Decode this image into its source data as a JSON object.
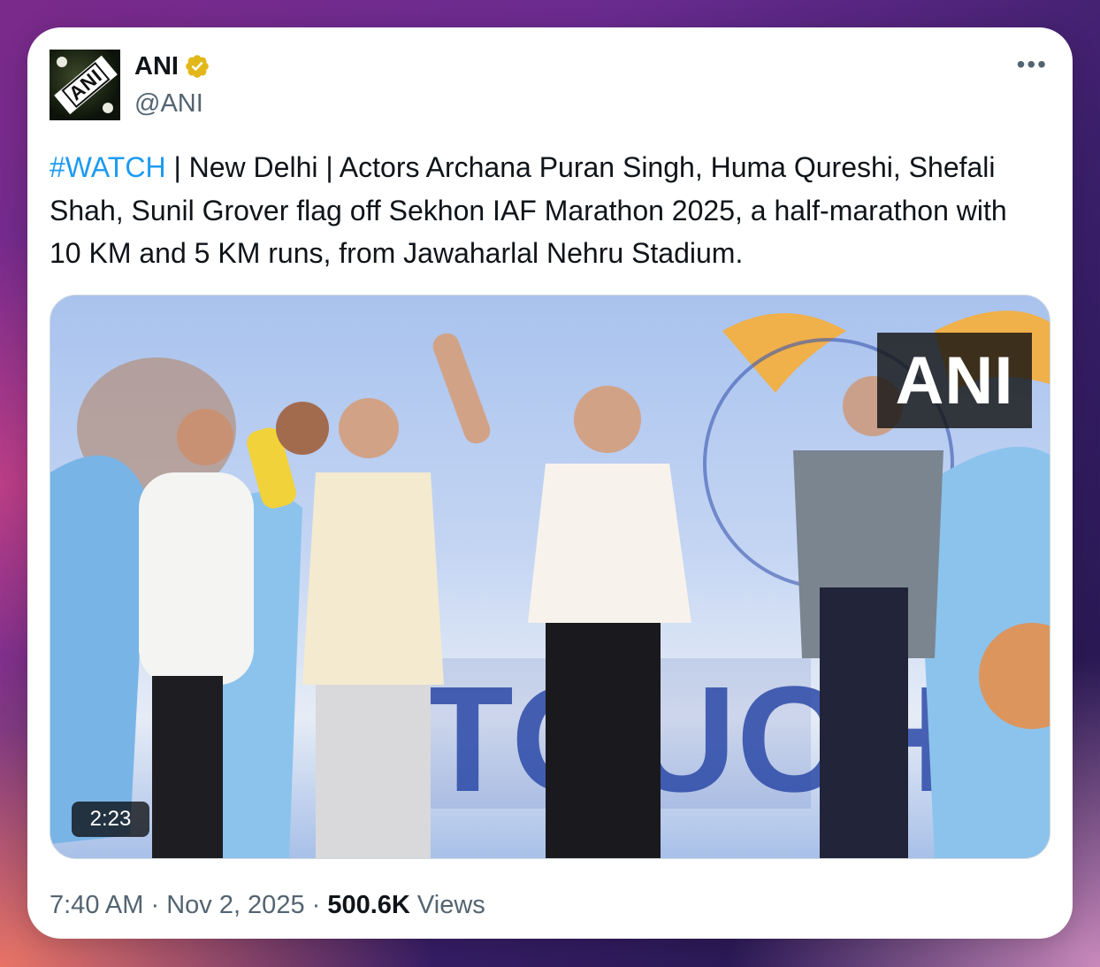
{
  "author": {
    "name": "ANI",
    "handle": "@ANI",
    "avatar_text": "ANI"
  },
  "more_menu_icon": "more-horizontal-icon",
  "tweet": {
    "hashtag": "#WATCH",
    "text": " | New Delhi | Actors Archana Puran Singh, Huma Qureshi, Shefali Shah, Sunil Grover flag off Sekhon IAF Marathon 2025, a half-marathon with 10 KM and 5 KM runs, from Jawaharlal Nehru Stadium."
  },
  "media": {
    "watermark": "ANI",
    "duration": "2:23"
  },
  "meta": {
    "time": "7:40 AM",
    "separator": " · ",
    "date": "Nov 2, 2025",
    "views_count": "500.6K",
    "views_label": " Views"
  },
  "colors": {
    "hashtag": "#1d9bf0",
    "verified_badge": "#e2b719",
    "secondary_text": "#536471"
  }
}
